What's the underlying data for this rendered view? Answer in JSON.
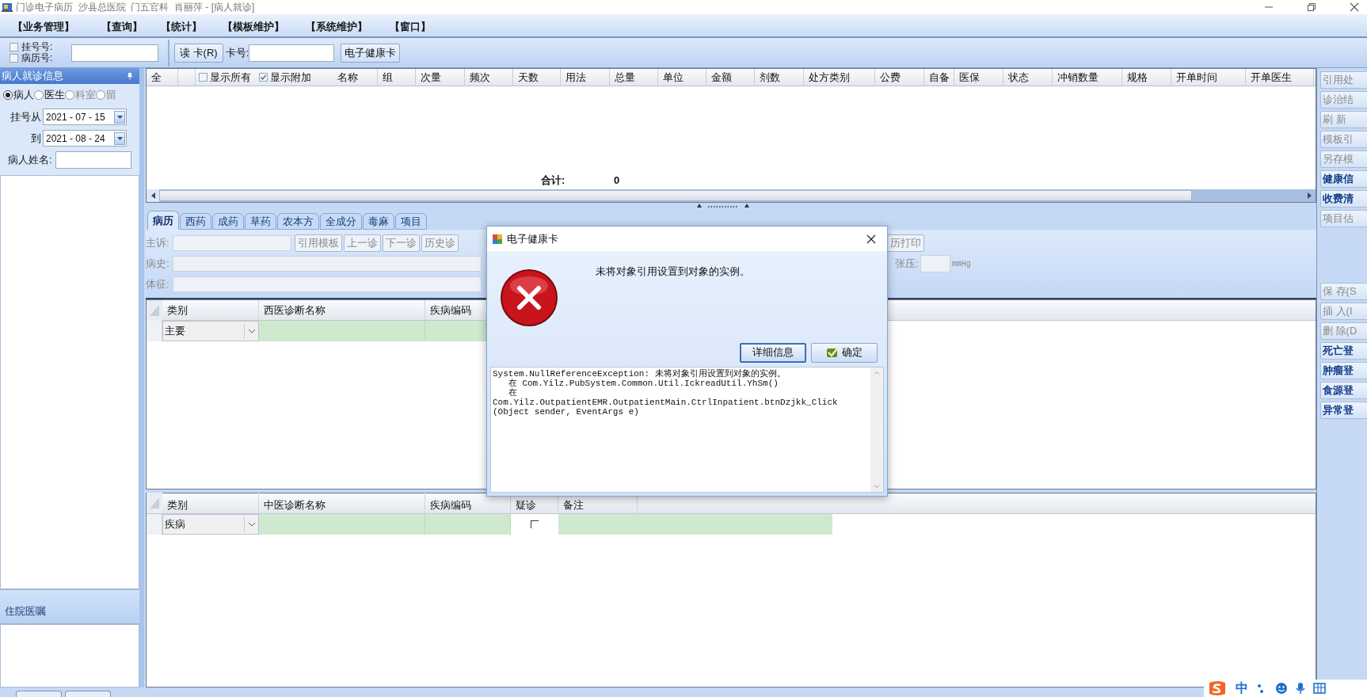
{
  "window": {
    "title": "门诊电子病历  沙县总医院  门五官科  肖丽萍 - [病人就诊]"
  },
  "menu": [
    "【业务管理】",
    "【查询】",
    "【统计】",
    "【模板维护】",
    "【系统维护】",
    "【窗口】"
  ],
  "toolbar": {
    "register_no": {
      "label": "挂号号:",
      "checked": false
    },
    "record_no": {
      "label": "病历号:",
      "checked": false
    },
    "read_card_button": "读 卡(R)",
    "card_no_label": "卡号:",
    "health_card_button": "电子健康卡"
  },
  "left_panel": {
    "title": "病人就诊信息",
    "filters": [
      {
        "label": "病人",
        "selected": true
      },
      {
        "label": "医生",
        "selected": false
      },
      {
        "label": "科室",
        "selected": false
      },
      {
        "label": "留",
        "selected": false
      }
    ],
    "date_from": {
      "label": "挂号从",
      "value": "2021 - 07 - 15"
    },
    "date_to": {
      "label": "到",
      "value": "2021 - 08 - 24"
    },
    "name_label": "病人姓名:",
    "orders_title": "住院医嘱"
  },
  "prescription_grid": {
    "select_all": "全",
    "show_all": {
      "label": "显示所有",
      "checked": false
    },
    "show_extra": {
      "label": "显示附加",
      "checked": true
    },
    "columns": [
      "名称",
      "组",
      "次量",
      "频次",
      "天数",
      "用法",
      "总量",
      "单位",
      "金额",
      "剂数",
      "处方类别",
      "公费",
      "自备",
      "医保",
      "状态",
      "冲销数量",
      "规格",
      "开单时间",
      "开单医生"
    ],
    "total_label": "合计:",
    "total_value": "0"
  },
  "tabs": [
    {
      "label": "病历",
      "selected": true
    },
    {
      "label": "西药",
      "selected": false
    },
    {
      "label": "成药",
      "selected": false
    },
    {
      "label": "草药",
      "selected": false
    },
    {
      "label": "农本方",
      "selected": false
    },
    {
      "label": "全成分",
      "selected": false
    },
    {
      "label": "毒麻",
      "selected": false
    },
    {
      "label": "项目",
      "selected": false
    }
  ],
  "record_form": {
    "complaint_label": "主诉:",
    "buttons": [
      "引用模板",
      "上一诊",
      "下一诊",
      "历史诊"
    ],
    "print_button": "历打印",
    "history_label": "病史:",
    "signs_label": "体征:",
    "bp_label": "张压:",
    "bp_unit": "mmHg"
  },
  "western_dx": {
    "columns": [
      "类别",
      "西医诊断名称",
      "疾病编码"
    ],
    "rows": [
      {
        "category": "主要"
      }
    ]
  },
  "tcm_dx": {
    "columns": [
      "类别",
      "中医诊断名称",
      "疾病编码",
      "疑诊",
      "备注"
    ],
    "rows": [
      {
        "category": "疾病",
        "suspected": false
      }
    ]
  },
  "sidebar_buttons": [
    {
      "label": "引用处",
      "disabled": true
    },
    {
      "label": "诊治结",
      "disabled": true
    },
    {
      "label": "刷 新",
      "disabled": true
    },
    {
      "label": "模板引",
      "disabled": true
    },
    {
      "label": "另存模",
      "disabled": true
    },
    {
      "label": "健康信",
      "disabled": false
    },
    {
      "label": "收费清",
      "disabled": false
    },
    {
      "label": "项目估",
      "disabled": true
    },
    {
      "label": "保 存(S",
      "disabled": true
    },
    {
      "label": "插 入(I",
      "disabled": true
    },
    {
      "label": "删 除(D",
      "disabled": true
    },
    {
      "label": "死亡登",
      "disabled": false
    },
    {
      "label": "肿瘤登",
      "disabled": false
    },
    {
      "label": "食源登",
      "disabled": false
    },
    {
      "label": "异常登",
      "disabled": false
    }
  ],
  "dialog": {
    "title": "电子健康卡",
    "message": "未将对象引用设置到对象的实例。",
    "buttons": [
      {
        "label": "详细信息",
        "kind": "details"
      },
      {
        "label": "确定",
        "kind": "ok"
      }
    ],
    "details": [
      "System.NullReferenceException: 未将对象引用设置到对象的实例。",
      "   在 Com.Yilz.PubSystem.Common.Util.IckreadUtil.YhSm()",
      "   在",
      "Com.Yilz.OutpatientEMR.OutpatientMain.CtrlInpatient.btnDzjkk_Click",
      "(Object sender, EventArgs e)"
    ]
  },
  "ime_toolbar": {
    "mode": "中"
  }
}
